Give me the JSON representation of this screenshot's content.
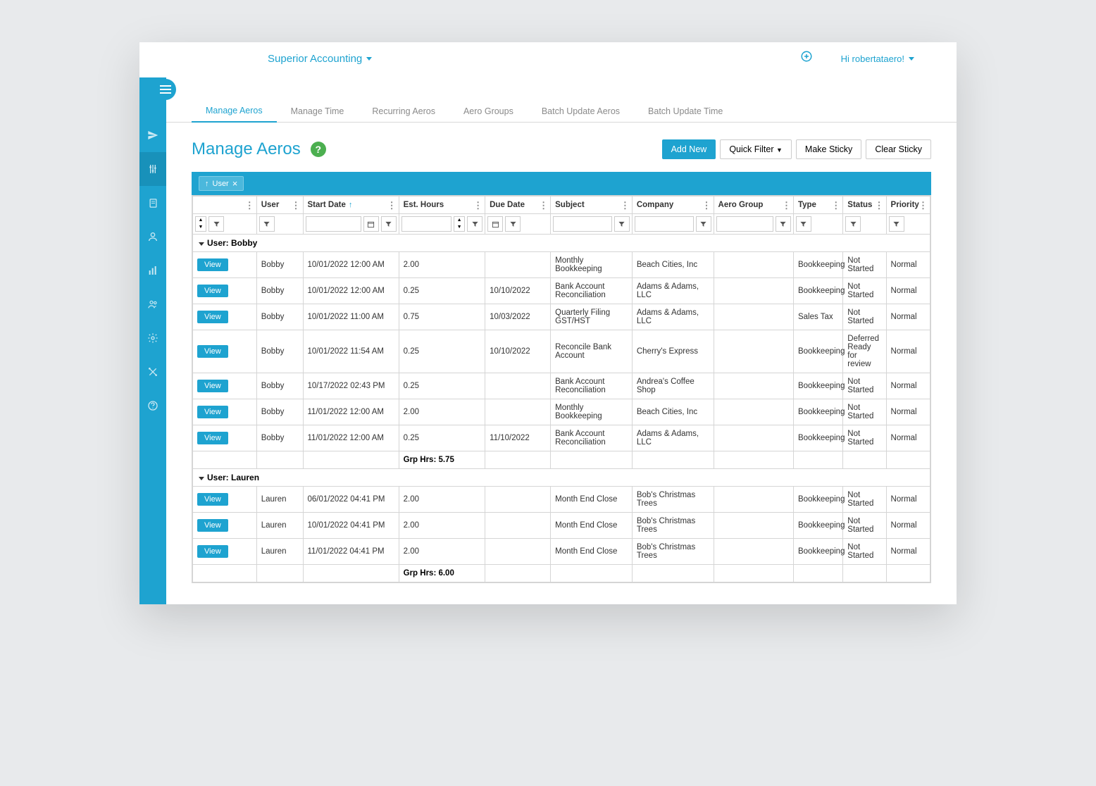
{
  "header": {
    "company": "Superior Accounting",
    "greeting": "Hi robertataero!"
  },
  "tabs": [
    "Manage Aeros",
    "Manage Time",
    "Recurring Aeros",
    "Aero Groups",
    "Batch Update Aeros",
    "Batch Update Time"
  ],
  "page": {
    "title": "Manage Aeros",
    "buttons": {
      "add": "Add New",
      "quickFilter": "Quick Filter",
      "makeSticky": "Make Sticky",
      "clearSticky": "Clear Sticky"
    }
  },
  "chip": {
    "label": "User"
  },
  "columns": [
    "",
    "User",
    "Start Date",
    "Est. Hours",
    "Due Date",
    "Subject",
    "Company",
    "Aero Group",
    "Type",
    "Status",
    "Priority"
  ],
  "groups": [
    {
      "label": "User: Bobby",
      "rows": [
        {
          "user": "Bobby",
          "start": "10/01/2022 12:00 AM",
          "hours": "2.00",
          "due": "",
          "subject": "Monthly Bookkeeping",
          "company": "Beach Cities, Inc",
          "group": "",
          "type": "Bookkeeping",
          "status": "Not Started",
          "priority": "Normal"
        },
        {
          "user": "Bobby",
          "start": "10/01/2022 12:00 AM",
          "hours": "0.25",
          "due": "10/10/2022",
          "subject": "Bank Account Reconciliation",
          "company": "Adams & Adams, LLC",
          "group": "",
          "type": "Bookkeeping",
          "status": "Not Started",
          "priority": "Normal"
        },
        {
          "user": "Bobby",
          "start": "10/01/2022 11:00 AM",
          "hours": "0.75",
          "due": "10/03/2022",
          "subject": "Quarterly Filing GST/HST",
          "company": "Adams & Adams, LLC",
          "group": "",
          "type": "Sales Tax",
          "status": "Not Started",
          "priority": "Normal"
        },
        {
          "user": "Bobby",
          "start": "10/01/2022 11:54 AM",
          "hours": "0.25",
          "due": "10/10/2022",
          "subject": "Reconcile Bank Account",
          "company": "Cherry's Express",
          "group": "",
          "type": "Bookkeeping",
          "status": "Deferred Ready for review",
          "priority": "Normal"
        },
        {
          "user": "Bobby",
          "start": "10/17/2022 02:43 PM",
          "hours": "0.25",
          "due": "",
          "subject": "Bank Account Reconciliation",
          "company": "Andrea's Coffee Shop",
          "group": "",
          "type": "Bookkeeping",
          "status": "Not Started",
          "priority": "Normal"
        },
        {
          "user": "Bobby",
          "start": "11/01/2022 12:00 AM",
          "hours": "2.00",
          "due": "",
          "subject": "Monthly Bookkeeping",
          "company": "Beach Cities, Inc",
          "group": "",
          "type": "Bookkeeping",
          "status": "Not Started",
          "priority": "Normal"
        },
        {
          "user": "Bobby",
          "start": "11/01/2022 12:00 AM",
          "hours": "0.25",
          "due": "11/10/2022",
          "subject": "Bank Account Reconciliation",
          "company": "Adams & Adams, LLC",
          "group": "",
          "type": "Bookkeeping",
          "status": "Not Started",
          "priority": "Normal"
        }
      ],
      "footer": "Grp Hrs: 5.75"
    },
    {
      "label": "User: Lauren",
      "rows": [
        {
          "user": "Lauren",
          "start": "06/01/2022 04:41 PM",
          "hours": "2.00",
          "due": "",
          "subject": "Month End Close",
          "company": "Bob's Christmas Trees",
          "group": "",
          "type": "Bookkeeping",
          "status": "Not Started",
          "priority": "Normal"
        },
        {
          "user": "Lauren",
          "start": "10/01/2022 04:41 PM",
          "hours": "2.00",
          "due": "",
          "subject": "Month End Close",
          "company": "Bob's Christmas Trees",
          "group": "",
          "type": "Bookkeeping",
          "status": "Not Started",
          "priority": "Normal"
        },
        {
          "user": "Lauren",
          "start": "11/01/2022 04:41 PM",
          "hours": "2.00",
          "due": "",
          "subject": "Month End Close",
          "company": "Bob's Christmas Trees",
          "group": "",
          "type": "Bookkeeping",
          "status": "Not Started",
          "priority": "Normal"
        }
      ],
      "footer": "Grp Hrs: 6.00"
    }
  ],
  "viewLabel": "View"
}
